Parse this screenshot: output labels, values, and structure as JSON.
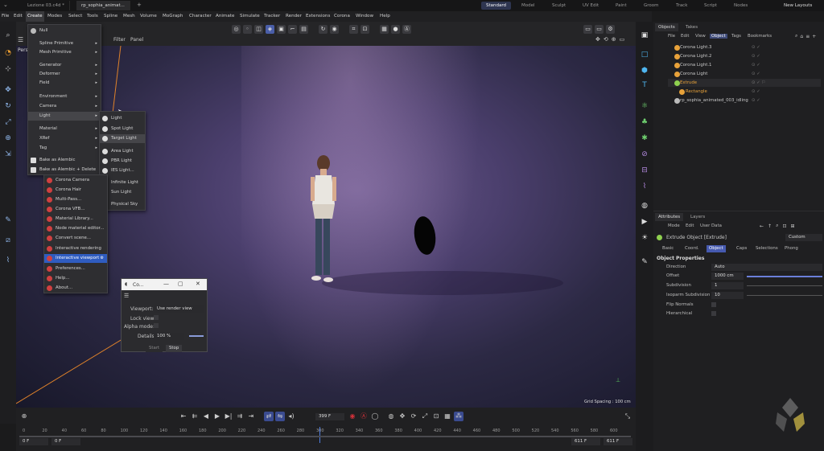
{
  "title_bar": {
    "tabs": [
      "Lezione 03.c4d *",
      "rp_sophia_animat..."
    ],
    "layouts": [
      "Standard",
      "Model",
      "Sculpt",
      "UV Edit",
      "Paint",
      "Groom",
      "Track",
      "Script",
      "Nodes"
    ],
    "active_layout": "Standard",
    "new_layouts": "New Layouts"
  },
  "menubar": [
    "File",
    "Edit",
    "Create",
    "Modes",
    "Select",
    "Tools",
    "Spline",
    "Mesh",
    "Volume",
    "MoGraph",
    "Character",
    "Animate",
    "Simulate",
    "Tracker",
    "Render",
    "Extensions",
    "Corona",
    "Window",
    "Help"
  ],
  "viewport_menu": [
    "Filter",
    "Panel"
  ],
  "viewport_label": "Pers",
  "grid_spacing": "Grid Spacing : 100 cm",
  "create_menu": {
    "items": [
      {
        "label": "Null"
      },
      {
        "label": "Spline Primitive",
        "sub": true
      },
      {
        "label": "Mesh Primitive",
        "sub": true
      },
      {
        "label": "Generator",
        "sub": true
      },
      {
        "label": "Deformer",
        "sub": true
      },
      {
        "label": "Field",
        "sub": true
      },
      {
        "label": "Environment",
        "sub": true
      },
      {
        "label": "Camera",
        "sub": true
      },
      {
        "label": "Light",
        "sub": true
      },
      {
        "label": "Material",
        "sub": true
      },
      {
        "label": "XRef",
        "sub": true
      },
      {
        "label": "Tag",
        "sub": true
      },
      {
        "label": "Bake as Alembic"
      },
      {
        "label": "Bake as Alembic + Delete"
      }
    ]
  },
  "light_submenu": [
    "Light",
    "Spot Light",
    "Target Light",
    "Area Light",
    "PBR Light",
    "IES Light...",
    "Infinite Light",
    "Sun Light",
    "Physical Sky"
  ],
  "corona_menu": [
    "Corona Camera",
    "Corona Hair",
    "Multi-Pass...",
    "Corona VFB...",
    "Material Library...",
    "Node material editor...",
    "Convert scene...",
    "Interactive rendering",
    "Interactive viewport",
    "Preferences...",
    "Help...",
    "About..."
  ],
  "dialog": {
    "title": "Co...",
    "viewport_label": "Viewport:",
    "viewport_value": "Use render view",
    "lock_view": "Lock view:",
    "alpha_mode": "Alpha mode:",
    "details_label": "Details:",
    "details_value": "100 %",
    "start": "Start",
    "stop": "Stop"
  },
  "objects_panel": {
    "tabs": [
      "Objects",
      "Takes"
    ],
    "menu": [
      "File",
      "Edit",
      "View",
      "Object",
      "Tags",
      "Bookmarks"
    ],
    "active_menu": "Object",
    "rows": [
      {
        "name": "Corona Light.3",
        "color": "#e8a23a"
      },
      {
        "name": "Corona Light.2",
        "color": "#e8a23a"
      },
      {
        "name": "Corona Light.1",
        "color": "#e8a23a"
      },
      {
        "name": "Corona Light",
        "color": "#e8a23a"
      },
      {
        "name": "Extrude",
        "color": "#8fd14f"
      },
      {
        "name": "Rectangle",
        "color": "#e8a23a"
      },
      {
        "name": "rp_sophia_animated_003_idling",
        "color": "#bbbbbb"
      }
    ]
  },
  "attributes_panel": {
    "tabs": [
      "Attributes",
      "Layers"
    ],
    "menu": [
      "Mode",
      "Edit",
      "User Data"
    ],
    "object_label": "Extrude Object [Extrude]",
    "preset": "Custom",
    "subtabs": [
      "Basic",
      "Coord.",
      "Object",
      "Caps",
      "Selections",
      "Phong"
    ],
    "active_subtab": "Object",
    "section": "Object Properties",
    "props": [
      {
        "label": "Direction",
        "value": "Auto"
      },
      {
        "label": "Offset",
        "value": "1000 cm"
      },
      {
        "label": "Subdivision",
        "value": "1"
      },
      {
        "label": "Isoparm Subdivision",
        "value": "10"
      },
      {
        "label": "Flip Normals",
        "value": ""
      },
      {
        "label": "Hierarchical",
        "value": ""
      }
    ]
  },
  "timeline": {
    "current_frame": "399 F",
    "start": "0 F",
    "start2": "0 F",
    "end": "611 F",
    "end2": "611 F",
    "ticks": [
      "0",
      "20",
      "40",
      "60",
      "80",
      "100",
      "120",
      "140",
      "160",
      "180",
      "200",
      "220",
      "240",
      "260",
      "280",
      "300",
      "320",
      "340",
      "360",
      "380",
      "400",
      "420",
      "440",
      "460",
      "480",
      "500",
      "520",
      "540",
      "560",
      "580",
      "600"
    ]
  },
  "colors": {
    "accent": "#2f5cc0",
    "light_icon": "#e8a23a",
    "extrude_icon": "#8fd14f",
    "record": "#d0313a"
  }
}
